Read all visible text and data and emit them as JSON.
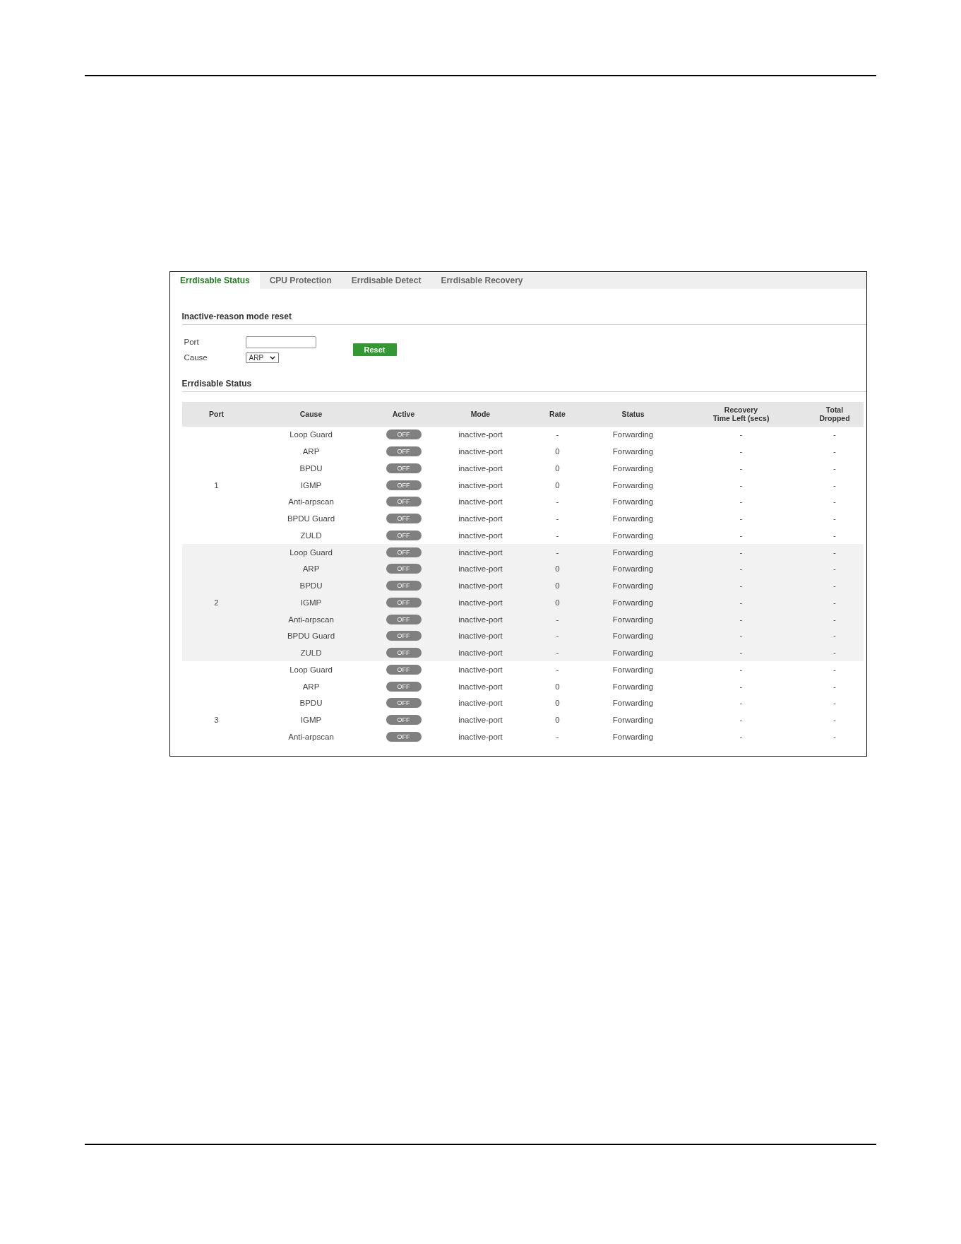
{
  "tabs": [
    {
      "label": "Errdisable Status",
      "selected": true
    },
    {
      "label": "CPU Protection",
      "selected": false
    },
    {
      "label": "Errdisable Detect",
      "selected": false
    },
    {
      "label": "Errdisable Recovery",
      "selected": false
    }
  ],
  "reset_section": {
    "title": "Inactive-reason mode reset",
    "port_field": {
      "label": "Port"
    },
    "cause_field": {
      "label": "Cause",
      "value": "ARP"
    },
    "reset_button": "Reset"
  },
  "status_section": {
    "title": "Errdisable Status",
    "columns": [
      "Port",
      "Cause",
      "Active",
      "Mode",
      "Rate",
      "Status",
      "Recovery\nTime Left (secs)",
      "Total\nDropped"
    ],
    "ports": [
      {
        "port": "1",
        "rows": [
          {
            "cause": "Loop Guard",
            "active": {
              "label": "OFF",
              "on": false
            },
            "mode": "inactive-port",
            "rate": "-",
            "status": "Forwarding",
            "recovery_time_left": "-",
            "total_dropped": "-"
          },
          {
            "cause": "ARP",
            "active": {
              "label": "OFF",
              "on": false
            },
            "mode": "inactive-port",
            "rate": "0",
            "status": "Forwarding",
            "recovery_time_left": "-",
            "total_dropped": "-"
          },
          {
            "cause": "BPDU",
            "active": {
              "label": "OFF",
              "on": false
            },
            "mode": "inactive-port",
            "rate": "0",
            "status": "Forwarding",
            "recovery_time_left": "-",
            "total_dropped": "-"
          },
          {
            "cause": "IGMP",
            "active": {
              "label": "OFF",
              "on": false
            },
            "mode": "inactive-port",
            "rate": "0",
            "status": "Forwarding",
            "recovery_time_left": "-",
            "total_dropped": "-"
          },
          {
            "cause": "Anti-arpscan",
            "active": {
              "label": "OFF",
              "on": false
            },
            "mode": "inactive-port",
            "rate": "-",
            "status": "Forwarding",
            "recovery_time_left": "-",
            "total_dropped": "-"
          },
          {
            "cause": "BPDU Guard",
            "active": {
              "label": "OFF",
              "on": false
            },
            "mode": "inactive-port",
            "rate": "-",
            "status": "Forwarding",
            "recovery_time_left": "-",
            "total_dropped": "-"
          },
          {
            "cause": "ZULD",
            "active": {
              "label": "OFF",
              "on": false
            },
            "mode": "inactive-port",
            "rate": "-",
            "status": "Forwarding",
            "recovery_time_left": "-",
            "total_dropped": "-"
          }
        ]
      },
      {
        "port": "2",
        "rows": [
          {
            "cause": "Loop Guard",
            "active": {
              "label": "OFF",
              "on": false
            },
            "mode": "inactive-port",
            "rate": "-",
            "status": "Forwarding",
            "recovery_time_left": "-",
            "total_dropped": "-"
          },
          {
            "cause": "ARP",
            "active": {
              "label": "OFF",
              "on": false
            },
            "mode": "inactive-port",
            "rate": "0",
            "status": "Forwarding",
            "recovery_time_left": "-",
            "total_dropped": "-"
          },
          {
            "cause": "BPDU",
            "active": {
              "label": "OFF",
              "on": false
            },
            "mode": "inactive-port",
            "rate": "0",
            "status": "Forwarding",
            "recovery_time_left": "-",
            "total_dropped": "-"
          },
          {
            "cause": "IGMP",
            "active": {
              "label": "OFF",
              "on": false
            },
            "mode": "inactive-port",
            "rate": "0",
            "status": "Forwarding",
            "recovery_time_left": "-",
            "total_dropped": "-"
          },
          {
            "cause": "Anti-arpscan",
            "active": {
              "label": "OFF",
              "on": false
            },
            "mode": "inactive-port",
            "rate": "-",
            "status": "Forwarding",
            "recovery_time_left": "-",
            "total_dropped": "-"
          },
          {
            "cause": "BPDU Guard",
            "active": {
              "label": "OFF",
              "on": false
            },
            "mode": "inactive-port",
            "rate": "-",
            "status": "Forwarding",
            "recovery_time_left": "-",
            "total_dropped": "-"
          },
          {
            "cause": "ZULD",
            "active": {
              "label": "OFF",
              "on": false
            },
            "mode": "inactive-port",
            "rate": "-",
            "status": "Forwarding",
            "recovery_time_left": "-",
            "total_dropped": "-"
          }
        ]
      },
      {
        "port": "3",
        "rows": [
          {
            "cause": "Loop Guard",
            "active": {
              "label": "OFF",
              "on": false
            },
            "mode": "inactive-port",
            "rate": "-",
            "status": "Forwarding",
            "recovery_time_left": "-",
            "total_dropped": "-"
          },
          {
            "cause": "ARP",
            "active": {
              "label": "OFF",
              "on": false
            },
            "mode": "inactive-port",
            "rate": "0",
            "status": "Forwarding",
            "recovery_time_left": "-",
            "total_dropped": "-"
          },
          {
            "cause": "BPDU",
            "active": {
              "label": "OFF",
              "on": false
            },
            "mode": "inactive-port",
            "rate": "0",
            "status": "Forwarding",
            "recovery_time_left": "-",
            "total_dropped": "-"
          },
          {
            "cause": "IGMP",
            "active": {
              "label": "OFF",
              "on": false
            },
            "mode": "inactive-port",
            "rate": "0",
            "status": "Forwarding",
            "recovery_time_left": "-",
            "total_dropped": "-"
          },
          {
            "cause": "Anti-arpscan",
            "active": {
              "label": "OFF",
              "on": false
            },
            "mode": "inactive-port",
            "rate": "-",
            "status": "Forwarding",
            "recovery_time_left": "-",
            "total_dropped": "-"
          }
        ]
      }
    ]
  }
}
